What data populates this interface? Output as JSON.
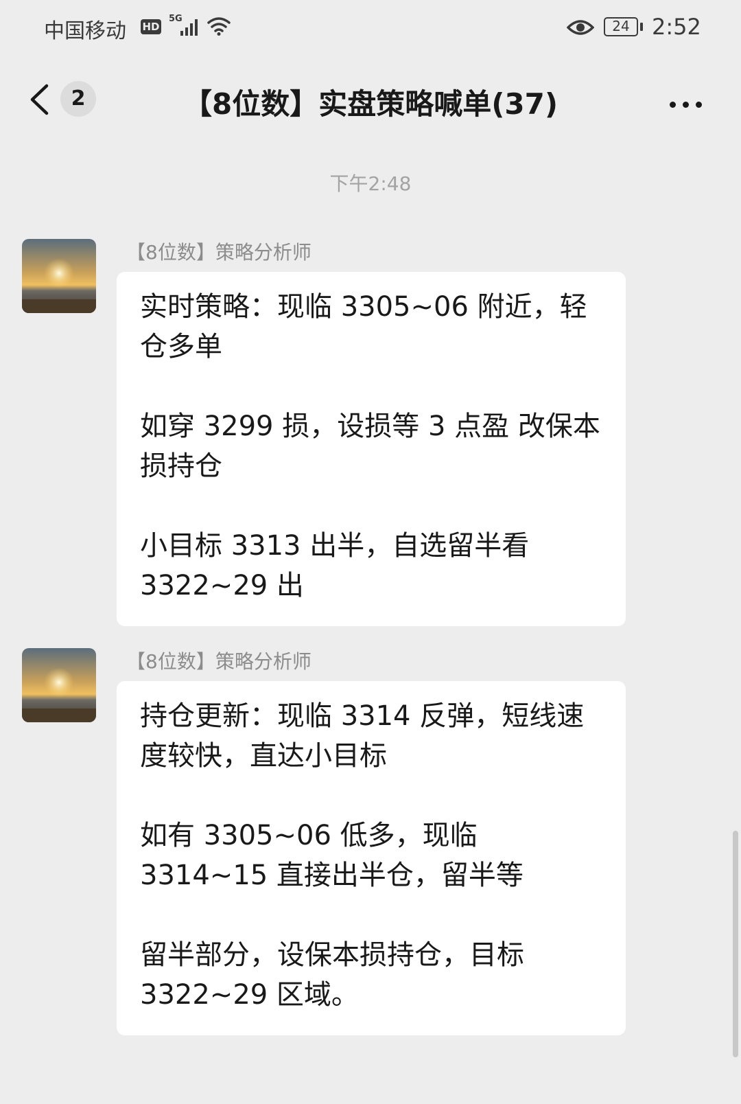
{
  "status_bar": {
    "carrier": "中国移动",
    "hd_badge": "HD",
    "network": "5G",
    "battery": "24",
    "time": "2:52",
    "icons": [
      "signal-icon",
      "wifi-icon",
      "eye-icon",
      "battery-icon"
    ]
  },
  "header": {
    "unread_count": "2",
    "title": "【8位数】实盘策略喊单(37)"
  },
  "timestamp": "下午2:48",
  "messages": [
    {
      "sender": "【8位数】策略分析师",
      "paragraphs": [
        "实时策略：现临 3305~06 附近，轻仓多单",
        "如穿 3299 损，设损等 3 点盈  改保本损持仓",
        "小目标 3313 出半，自选留半看 3322~29 出"
      ]
    },
    {
      "sender": "【8位数】策略分析师",
      "paragraphs": [
        "持仓更新：现临 3314 反弹，短线速度较快，直达小目标",
        "如有 3305~06 低多，现临 3314~15 直接出半仓，留半等",
        "留半部分，设保本损持仓，目标 3322~29 区域。"
      ]
    }
  ],
  "colors": {
    "background": "#ededed",
    "bubble": "#ffffff",
    "text": "#191919",
    "secondary_text": "#8c8c8c"
  }
}
